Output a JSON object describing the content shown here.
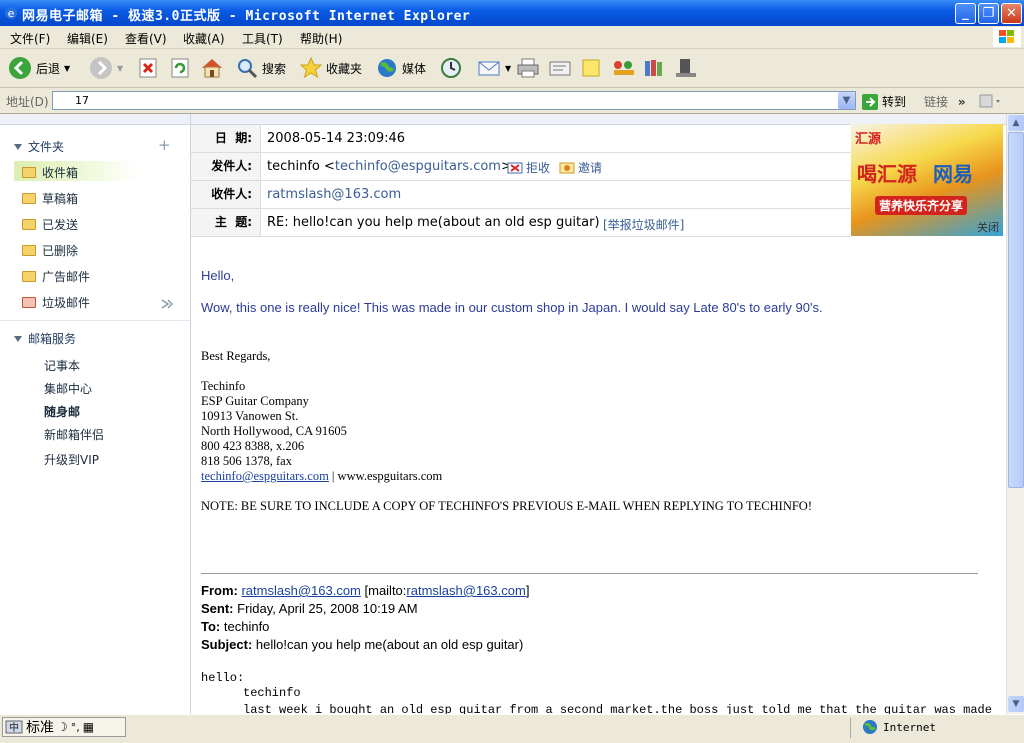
{
  "window": {
    "title": "网易电子邮箱 - 极速3.0正式版 - Microsoft Internet Explorer"
  },
  "menubar": {
    "items": [
      "文件(F)",
      "编辑(E)",
      "查看(V)",
      "收藏(A)",
      "工具(T)",
      "帮助(H)"
    ]
  },
  "toolbar": {
    "back": "后退",
    "search": "搜索",
    "favorites": "收藏夹",
    "media": "媒体"
  },
  "address": {
    "label": "地址(D)",
    "value": "17",
    "go": "转到",
    "links": "链接"
  },
  "sidebar": {
    "folders_title": "文件夹",
    "folders_add": "+",
    "folders": [
      "收件箱",
      "草稿箱",
      "已发送",
      "已删除",
      "广告邮件",
      "垃圾邮件"
    ],
    "services_title": "邮箱服务",
    "services": [
      "记事本",
      "集邮中心",
      "随身邮",
      "新邮箱伴侣",
      "升级到VIP"
    ]
  },
  "email": {
    "date_label": "日  期:",
    "date": "2008-05-14 23:09:46",
    "from_label": "发件人:",
    "from_name": "techinfo <",
    "from_addr": "techinfo@espguitars.com",
    "from_close": ">",
    "reject": "拒收",
    "invite": "邀请",
    "to_label": "收件人:",
    "to": "ratmslash@163.com",
    "subject_label": "主  题:",
    "subject": "RE: hello!can you help me(about an old esp guitar)",
    "report_spam": "[举报垃圾邮件]",
    "body_hello": "Hello,",
    "body_msg": "Wow, this one is really nice! This was made in our custom shop in Japan. I would say Late 80's to early 90's.",
    "regards": "Best Regards,",
    "sig": [
      "Techinfo",
      "ESP Guitar Company",
      "10913 Vanowen St.",
      "North Hollywood, CA 91605",
      "800 423 8388, x.206",
      "818 506 1378, fax"
    ],
    "sig_email": "techinfo@espguitars.com",
    "sig_web": " | www.espguitars.com",
    "note": "NOTE: BE SURE TO INCLUDE A COPY OF TECHINFO'S PREVIOUS E-MAIL WHEN REPLYING TO TECHINFO!",
    "quote": {
      "from_label": "From:",
      "from_addr": "ratmslash@163.com",
      "mailto_pre": "[mailto:",
      "mailto_addr": "ratmslash@163.com",
      "mailto_post": "]",
      "sent_label": "Sent:",
      "sent": "Friday, April 25, 2008 10:19 AM",
      "to_label": "To:",
      "to": "techinfo",
      "subject_label": "Subject:",
      "subject": "hello!can you help me(about an old esp guitar)",
      "hello": "hello:",
      "line1": "techinfo",
      "line2": "last week i bought an old esp guitar from a second market.the boss just told me that the guitar was made"
    }
  },
  "ad": {
    "logo": "汇源",
    "line1": "喝汇源",
    "line2": "网易",
    "line3": "营养快乐齐分享",
    "close": "关闭"
  },
  "statusbar": {
    "ime": "标准",
    "zone": "Internet"
  }
}
